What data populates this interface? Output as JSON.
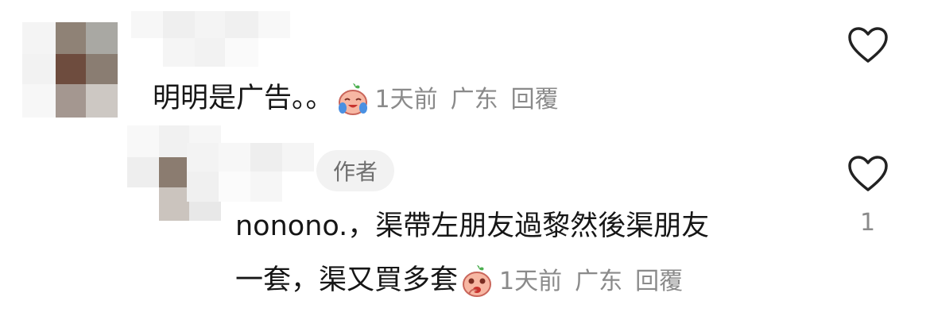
{
  "comment": {
    "text": "明明是广告。。",
    "meta": {
      "time": "1天前",
      "location": "广东",
      "reply_label": "回覆"
    },
    "emoji_icon": "crying-face-icon",
    "like_icon": "heart-outline-icon"
  },
  "reply": {
    "author_badge": "作者",
    "text_line1": "nonono.，渠帶左朋友過黎然後渠朋友",
    "text_line2": "一套，渠又買多套",
    "meta": {
      "time": "1天前",
      "location": "广东",
      "reply_label": "回覆"
    },
    "emoji_icon": "shy-face-icon",
    "like_icon": "heart-outline-icon",
    "like_count": "1"
  },
  "colors": {
    "text": "#161616",
    "meta": "#8a8a8a",
    "badge_bg": "#f2f2f2"
  }
}
